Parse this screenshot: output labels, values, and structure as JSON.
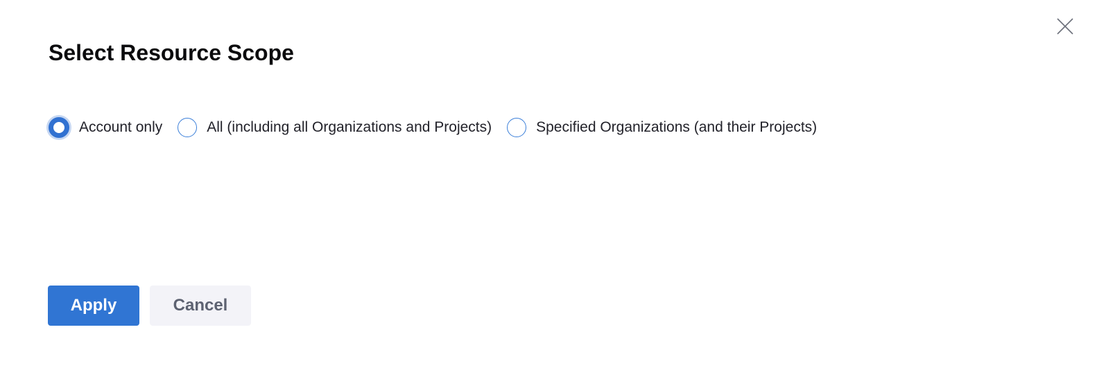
{
  "dialog": {
    "title": "Select Resource Scope",
    "close_icon": "close-icon"
  },
  "scope_options": [
    {
      "label": "Account only",
      "checked": true
    },
    {
      "label": "All (including all Organizations and Projects)",
      "checked": false
    },
    {
      "label": "Specified Organizations (and their Projects)",
      "checked": false
    }
  ],
  "buttons": {
    "apply_label": "Apply",
    "cancel_label": "Cancel"
  },
  "colors": {
    "primary": "#3075d3",
    "radio_border": "#3b7fd9",
    "secondary_bg": "#f3f3f8",
    "secondary_text": "#5d6271",
    "title_text": "#0b0b0d"
  }
}
